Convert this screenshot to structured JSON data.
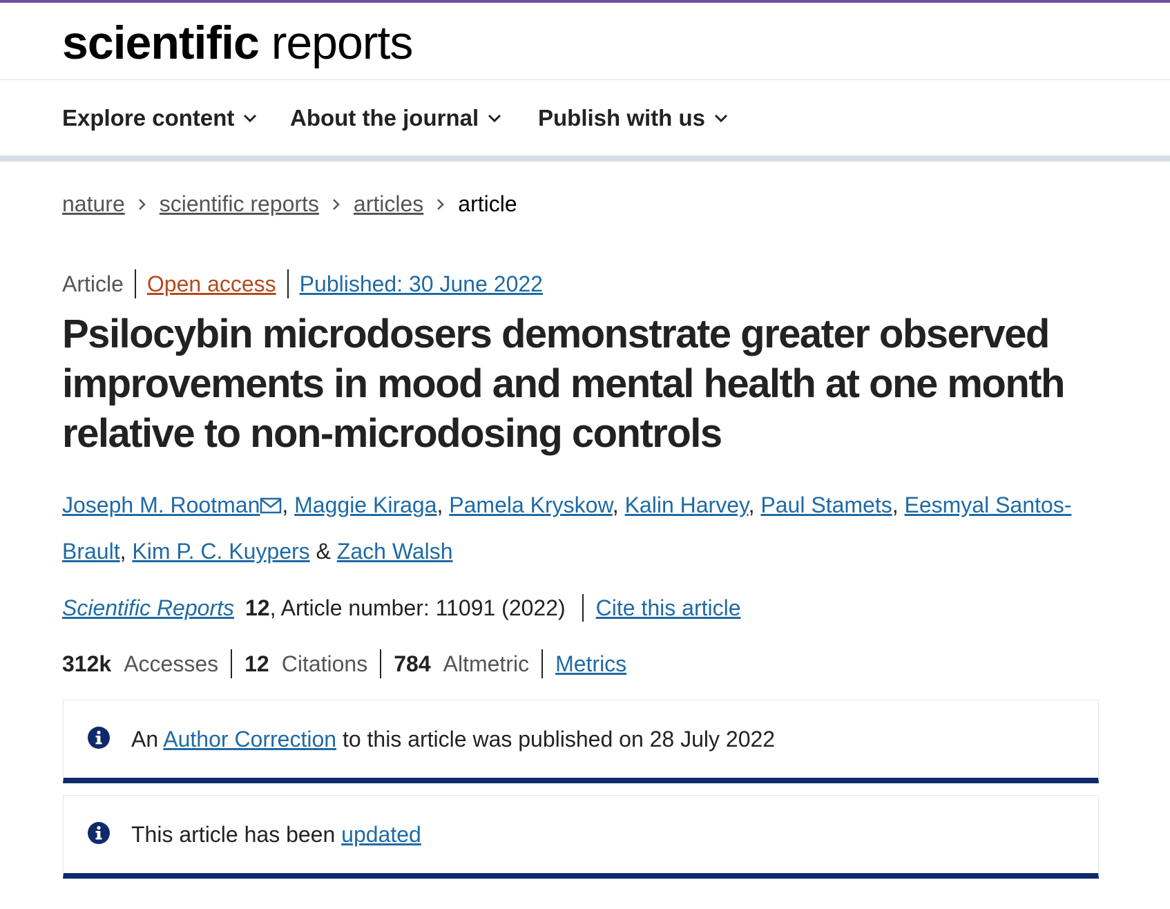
{
  "brand": {
    "name_bold": "scientific",
    "name_light": "reports",
    "accent": "#6b4fa0"
  },
  "nav": [
    {
      "label": "Explore content"
    },
    {
      "label": "About the journal"
    },
    {
      "label": "Publish with us"
    }
  ],
  "breadcrumb": {
    "items": [
      "nature",
      "scientific reports",
      "articles"
    ],
    "current": "article"
  },
  "article": {
    "type": "Article",
    "open_access": "Open access",
    "published": "Published: 30 June 2022",
    "title": "Psilocybin microdosers demonstrate greater observed improvements in mood and mental health at one month relative to non-microdosing controls",
    "authors": [
      "Joseph M. Rootman",
      "Maggie Kiraga",
      "Pamela Kryskow",
      "Kalin Harvey",
      "Paul Stamets",
      "Eesmyal Santos-Brault",
      "Kim P. C. Kuypers",
      "Zach Walsh"
    ],
    "author_sep": ", ",
    "author_last_sep": " & ",
    "journal": "Scientific Reports",
    "volume": "12",
    "article_number_text": ", Article number: 11091 (2022)",
    "cite_label": "Cite this article"
  },
  "metrics": {
    "accesses_value": "312k",
    "accesses_label": "Accesses",
    "citations_value": "12",
    "citations_label": "Citations",
    "altmetric_value": "784",
    "altmetric_label": "Altmetric",
    "metrics_link": "Metrics"
  },
  "notices": {
    "correction": {
      "prefix": "An",
      "link": "Author Correction",
      "suffix": "to this article was published on 28 July 2022"
    },
    "updated": {
      "prefix": "This article has been",
      "link": "updated"
    }
  },
  "colors": {
    "link": "#1f6aa5",
    "open_access": "#b24a1d",
    "notice_border": "#0f2a6b"
  }
}
